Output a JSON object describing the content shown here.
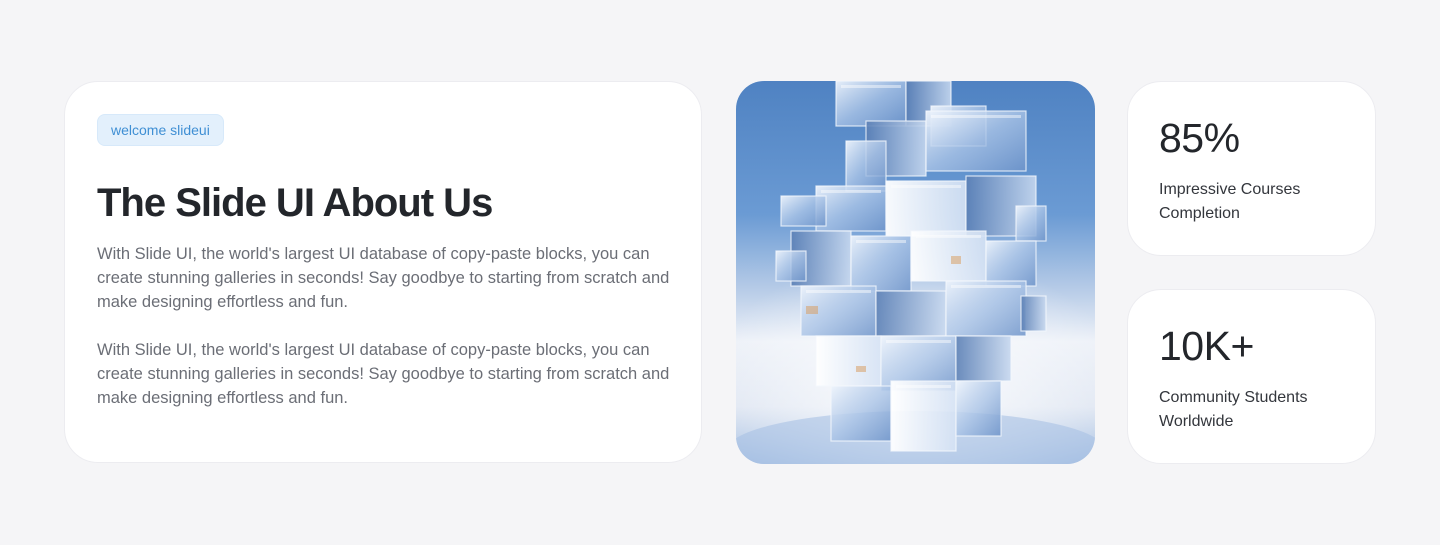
{
  "about": {
    "badge": "welcome slideui",
    "title": "The Slide UI About Us",
    "paragraphs": [
      "With Slide UI, the world's largest UI database of copy-paste blocks, you can create stunning galleries in seconds! Say goodbye to starting from scratch and make designing effortless and fun.",
      "With Slide UI, the world's largest UI database of copy-paste blocks, you can create stunning galleries in seconds! Say goodbye to starting from scratch and make designing effortless and fun."
    ]
  },
  "image": {
    "subject": "glass-cube-tower-image"
  },
  "stats": [
    {
      "value": "85%",
      "label": "Impressive Courses Completion"
    },
    {
      "value": "10K+",
      "label": "Community Students Worldwide"
    }
  ],
  "colors": {
    "background": "#f5f5f7",
    "card": "#ffffff",
    "badge_bg": "#e3f0fc",
    "badge_text": "#3f8fd4",
    "heading": "#23262b",
    "body_text": "#6b6e76",
    "sky_blue": "#5f8fcb"
  }
}
